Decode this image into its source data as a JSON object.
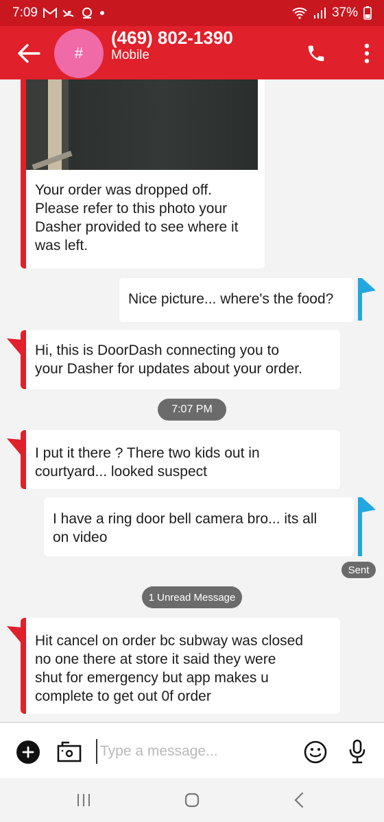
{
  "status_bar": {
    "time": "7:09",
    "battery": "37%",
    "icons": [
      "gmail-icon",
      "missed-call-icon",
      "app-notification-icon",
      "dot-icon",
      "wifi-icon",
      "signal-icon",
      "battery-icon"
    ]
  },
  "header": {
    "avatar_glyph": "#",
    "contact_number": "(469) 802-1390",
    "contact_type": "Mobile",
    "colors": {
      "header": "#e0202a",
      "status": "#c8171f",
      "avatar": "#f06aa8"
    }
  },
  "messages": [
    {
      "direction": "incoming",
      "has_photo": true,
      "text": "Your order was dropped off.\nPlease refer to this photo your\nDasher provided to see where it\nwas left."
    },
    {
      "direction": "outgoing",
      "text": "Nice picture... where's the food?"
    },
    {
      "direction": "incoming",
      "text": "Hi, this is DoorDash connecting you to\nyour Dasher for updates about your order."
    },
    {
      "direction": "incoming",
      "text": "I put it there ? There two kids out in\ncourtyard... looked suspect"
    },
    {
      "direction": "outgoing",
      "text": "I have a ring door bell camera bro... its all\non video"
    },
    {
      "direction": "incoming",
      "text": "Hit cancel on order bc subway was closed\nno one there  at store it said they were\nshut for emergency but app makes u\ncomplete to get out 0f order"
    }
  ],
  "timestamp_pill": "7:07 PM",
  "sent_label": "Sent",
  "unread_pill": "1 Unread Message",
  "compose": {
    "placeholder": "Type a message...",
    "value": ""
  },
  "colors": {
    "incoming_accent": "#e0202a",
    "outgoing_accent": "#22a7e0"
  }
}
